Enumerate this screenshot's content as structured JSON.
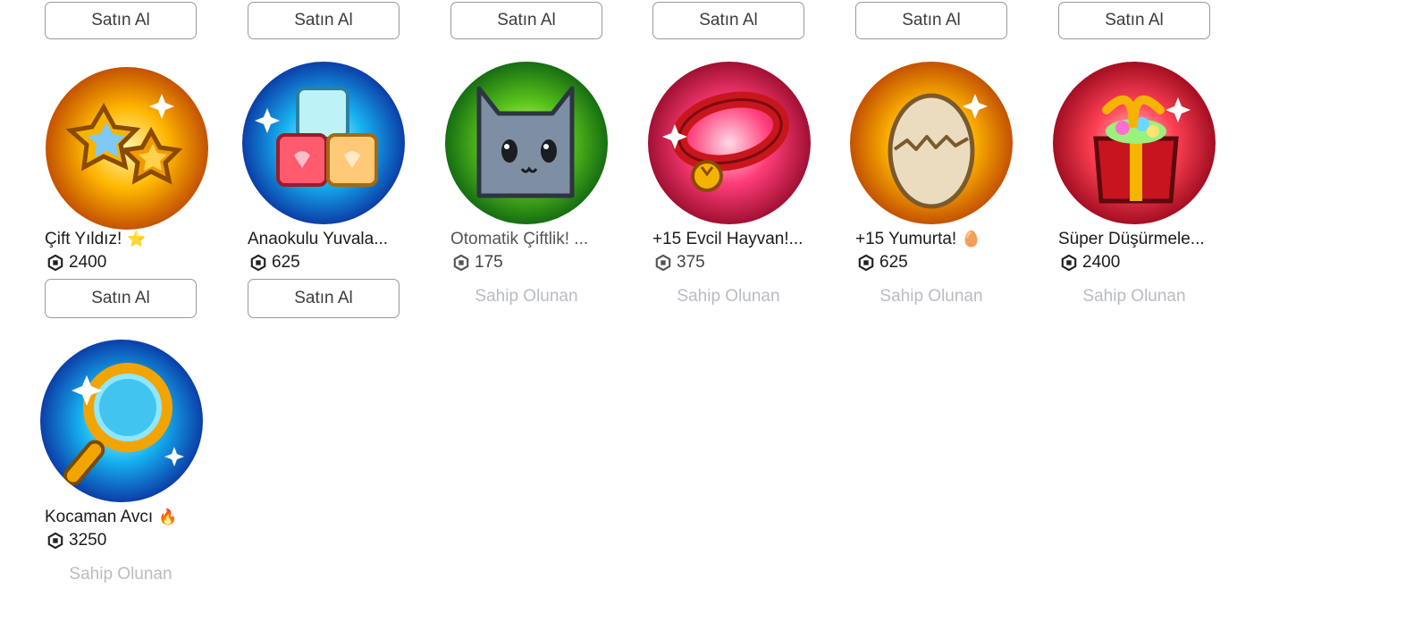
{
  "top_buttons": [
    "Satın Al",
    "Satın Al",
    "Satın Al",
    "Satın Al",
    "Satın Al",
    "Satın Al"
  ],
  "items": [
    {
      "name": "Çift Yıldız!",
      "emoji": "⭐",
      "price": "2400",
      "action": "Satın Al",
      "owned": false,
      "icon": "double-star-icon",
      "bg": "#f39a12"
    },
    {
      "name": "Anaokulu Yuvala...",
      "emoji": "",
      "price": "625",
      "action": "Satın Al",
      "owned": false,
      "icon": "blocks-icon",
      "bg": "#1f8fe6"
    },
    {
      "name": "Otomatik Çiftlik! ...",
      "emoji": "",
      "price": "175",
      "action": "Sahip Olunan",
      "owned": true,
      "icon": "cat-icon",
      "bg": "#49b022"
    },
    {
      "name": "+15 Evcil Hayvan!...",
      "emoji": "",
      "price": "375",
      "action": "Sahip Olunan",
      "owned": true,
      "icon": "collar-icon",
      "bg": "#f03a68"
    },
    {
      "name": "+15 Yumurta!",
      "emoji": "🥚",
      "price": "625",
      "action": "Sahip Olunan",
      "owned": true,
      "icon": "egg-icon",
      "bg": "#f39a12"
    },
    {
      "name": "Süper Düşürmele...",
      "emoji": "",
      "price": "2400",
      "action": "Sahip Olunan",
      "owned": true,
      "icon": "gift-icon",
      "bg": "#ef3a55"
    },
    {
      "name": "Kocaman Avcı",
      "emoji": "🔥",
      "price": "3250",
      "action": "Sahip Olunan",
      "owned": true,
      "icon": "magnifier-icon",
      "bg": "#1f7fe0"
    }
  ]
}
